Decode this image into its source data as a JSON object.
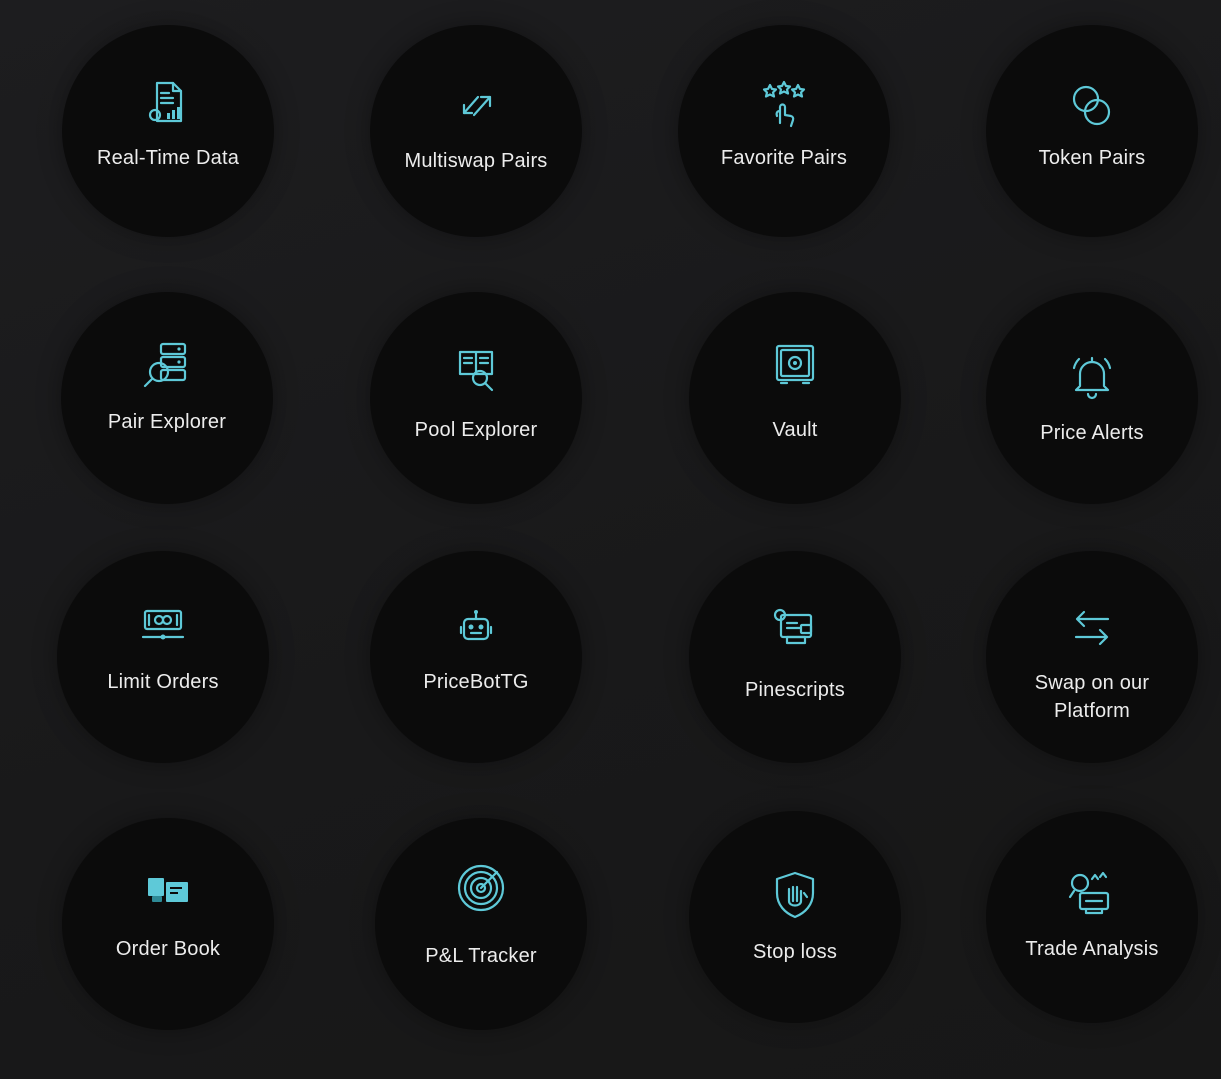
{
  "features": [
    {
      "label": "Real-Time Data",
      "icon": "realtime-data-icon"
    },
    {
      "label": "Multiswap Pairs",
      "icon": "multiswap-arrows-icon"
    },
    {
      "label": "Favorite Pairs",
      "icon": "favorite-stars-icon"
    },
    {
      "label": "Token Pairs",
      "icon": "token-coins-icon"
    },
    {
      "label": "Pair Explorer",
      "icon": "pair-explorer-icon"
    },
    {
      "label": "Pool Explorer",
      "icon": "pool-explorer-icon"
    },
    {
      "label": "Vault",
      "icon": "vault-icon"
    },
    {
      "label": "Price Alerts",
      "icon": "bell-icon"
    },
    {
      "label": "Limit Orders",
      "icon": "limit-orders-icon"
    },
    {
      "label": "PriceBotTG",
      "icon": "robot-icon"
    },
    {
      "label": "Pinescripts",
      "icon": "pinescripts-icon"
    },
    {
      "label": "Swap on our\nPlatform",
      "icon": "swap-arrows-icon"
    },
    {
      "label": "Order Book",
      "icon": "order-book-icon"
    },
    {
      "label": "P&L  Tracker",
      "icon": "radar-icon"
    },
    {
      "label": "Stop loss",
      "icon": "shield-hand-icon"
    },
    {
      "label": "Trade Analysis",
      "icon": "trade-analysis-icon"
    }
  ],
  "colors": {
    "background": "#1a1a1b",
    "tile": "#0b0b0b",
    "accent": "#5ec9d8",
    "text": "#ececec"
  }
}
